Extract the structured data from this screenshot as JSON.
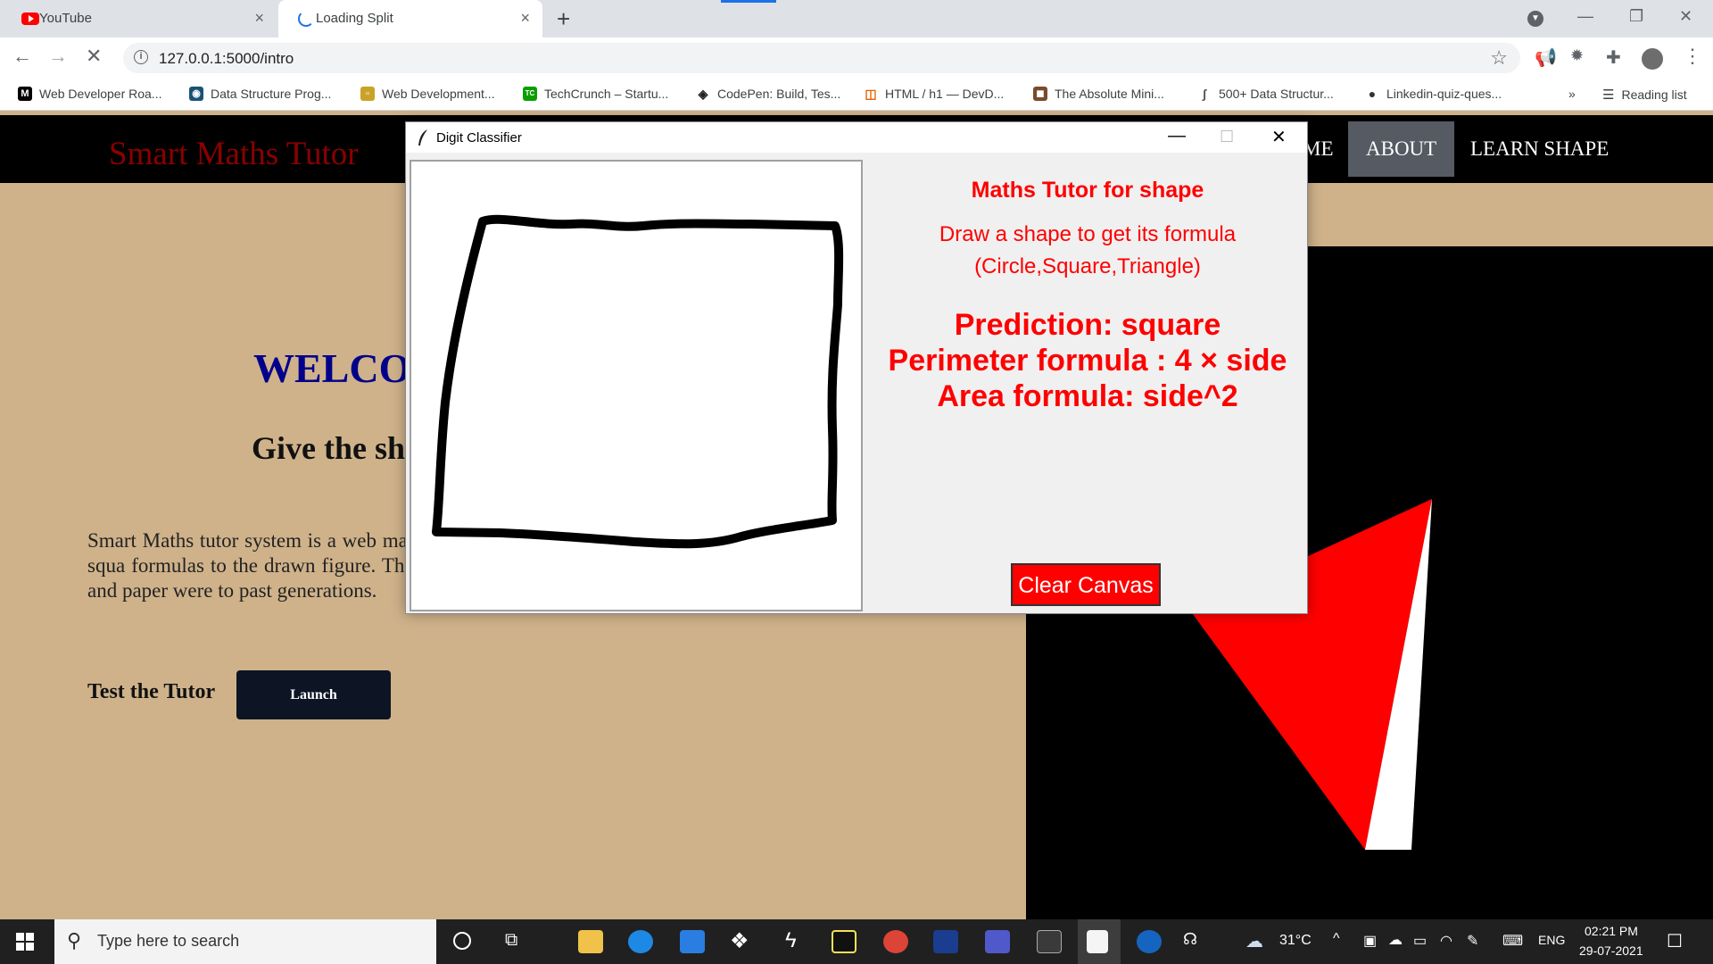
{
  "browser": {
    "tabs": [
      {
        "title": "YouTube",
        "close": "×"
      },
      {
        "title": "Loading Split",
        "close": "×"
      }
    ],
    "new_tab": "+",
    "url": "127.0.0.1:5000/intro",
    "bookmarks": [
      {
        "label": "Web Developer Roa...",
        "icon": "M",
        "color": "#000000"
      },
      {
        "label": "Data Structure Prog...",
        "icon": "◉",
        "color": "#1a5276"
      },
      {
        "label": "Web Development...",
        "icon": "▫",
        "color": "#c9a227"
      },
      {
        "label": "TechCrunch – Startu...",
        "icon": "TC",
        "color": "#0a9e01"
      },
      {
        "label": "CodePen: Build, Tes...",
        "icon": "◈",
        "color": "#222222"
      },
      {
        "label": "HTML / h1 — DevD...",
        "icon": "◫",
        "color": "#e66000"
      },
      {
        "label": "The Absolute Mini...",
        "icon": "◼",
        "color": "#7a4b2a"
      },
      {
        "label": "500+ Data Structur...",
        "icon": "ʃ",
        "color": "#555555"
      },
      {
        "label": "Linkedin-quiz-ques...",
        "icon": "●",
        "color": "#333333"
      }
    ],
    "more_bookmarks": "»",
    "reading_list": "Reading list"
  },
  "site": {
    "brand": "Smart Maths Tutor",
    "nav": [
      {
        "label": "ME"
      },
      {
        "label": "ABOUT"
      },
      {
        "label": "LEARN SHAPE"
      }
    ],
    "welcome": "WELCO",
    "give": "Give the sh",
    "description": "Smart Maths tutor system is a web mathematical figures such as squa formulas to the drawn figure. The natural as using a pencil and paper were to past generations.",
    "test_label": "Test the Tutor",
    "launch_label": "Launch",
    "colors": {
      "background": "#cfb28a",
      "brand": "#8b0000",
      "welcome": "#00008b"
    }
  },
  "tk_window": {
    "title": "Digit Classifier",
    "heading": "Maths Tutor for shape",
    "instruction_1": "Draw a shape to get its formula",
    "instruction_2": "(Circle,Square,Triangle)",
    "prediction": "Prediction: square",
    "perimeter": "Perimeter formula : 4 × side",
    "area": "Area formula: side^2",
    "clear_button": "Clear Canvas",
    "accent": "#ff0000"
  },
  "taskbar": {
    "search_placeholder": "Type here to search",
    "weather": "31°C",
    "language": "ENG",
    "time": "02:21 PM",
    "date": "29-07-2021"
  }
}
